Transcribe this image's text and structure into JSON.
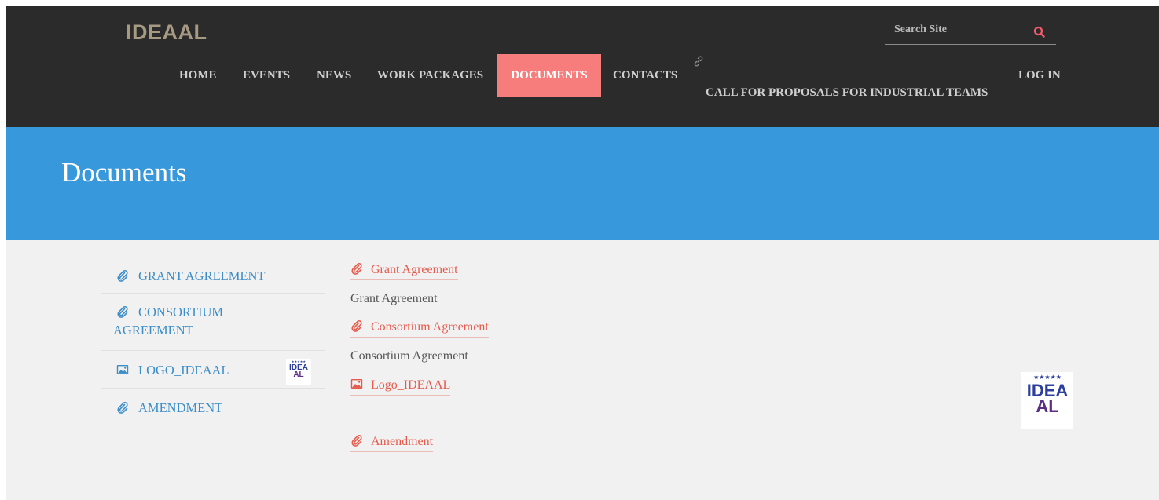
{
  "header": {
    "logo": "IDEAAL",
    "search": {
      "placeholder": "Search Site"
    },
    "nav": [
      {
        "label": "HOME"
      },
      {
        "label": "EVENTS"
      },
      {
        "label": "NEWS"
      },
      {
        "label": "WORK PACKAGES"
      },
      {
        "label": "DOCUMENTS",
        "active": true
      },
      {
        "label": "CONTACTS"
      },
      {
        "label": "CALL FOR PROPOSALS FOR INDUSTRIAL TEAMS"
      },
      {
        "label": "LOG IN"
      }
    ]
  },
  "banner": {
    "title": "Documents"
  },
  "sidebar": {
    "items": [
      {
        "label": "GRANT AGREEMENT",
        "icon": "paperclip-icon"
      },
      {
        "label_line1": "CONSORTIUM",
        "label_line2": "AGREEMENT",
        "icon": "paperclip-icon"
      },
      {
        "label": "LOGO_IDEAAL",
        "icon": "image-icon"
      },
      {
        "label": "AMENDMENT",
        "icon": "paperclip-icon"
      }
    ]
  },
  "documents": [
    {
      "title": "Grant Agreement",
      "description": "Grant Agreement",
      "icon": "paperclip-icon"
    },
    {
      "title": "Consortium Agreement",
      "description": "Consortium Agreement",
      "icon": "paperclip-icon"
    },
    {
      "title": "Logo_IDEAAL",
      "icon": "image-icon"
    },
    {
      "title": "Amendment",
      "icon": "paperclip-icon"
    }
  ],
  "logo_image": {
    "stars": "★★★★★",
    "line1": "IDEA",
    "line2": "AL"
  },
  "colors": {
    "header_bg": "#2b2b2b",
    "nav_active_bg": "#f77c7c",
    "banner_bg": "#3898dc",
    "content_bg": "#f1f1f1",
    "sidebar_link": "#3d8ec8",
    "doc_link": "#e65a4c"
  }
}
